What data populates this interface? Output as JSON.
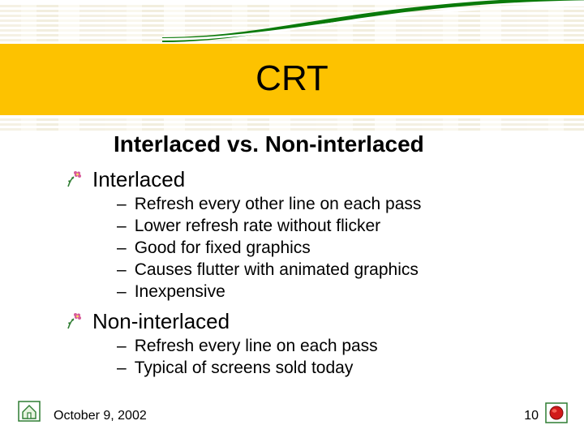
{
  "title": "CRT",
  "subtitle": "Interlaced vs. Non-interlaced",
  "sections": [
    {
      "heading": "Interlaced",
      "items": [
        "Refresh every other line on each pass",
        "Lower refresh rate without flicker",
        "Good for fixed graphics",
        "Causes flutter with animated graphics",
        "Inexpensive"
      ]
    },
    {
      "heading": "Non-interlaced",
      "items": [
        "Refresh every line on each pass",
        "Typical of screens sold today"
      ]
    }
  ],
  "footer": {
    "date": "October 9, 2002",
    "page": "10"
  },
  "colors": {
    "band": "#fdc200",
    "swoosh": "#008000",
    "bullet_leaf": "#2e7d32",
    "bullet_flower": "#d65a9a",
    "home_border": "#2e7d32",
    "home_fill": "#ffffff",
    "nav_border": "#2e7d32",
    "nav_dot": "#d11a1a"
  },
  "icons": {
    "bullet": "flower-bullet-icon",
    "home": "home-icon",
    "nav": "nav-next-icon"
  }
}
